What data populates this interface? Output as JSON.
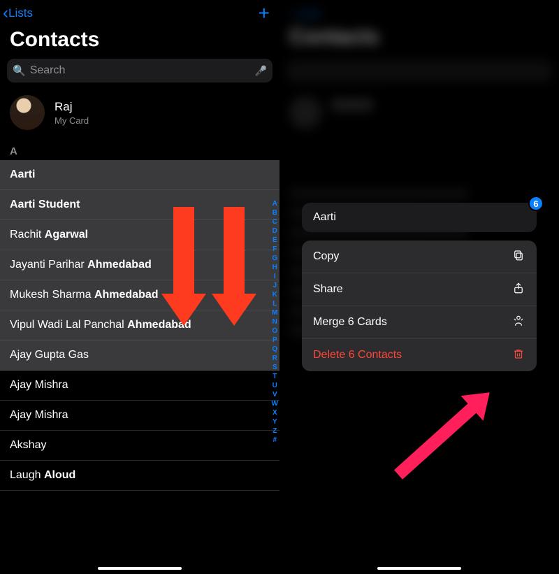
{
  "left": {
    "back_label": "Lists",
    "title": "Contacts",
    "search_placeholder": "Search",
    "me": {
      "name": "Raj",
      "subtitle": "My Card"
    },
    "section_letter": "A",
    "rows": [
      {
        "first": "",
        "last": "Aarti",
        "selected": true
      },
      {
        "first": "",
        "last": "Aarti Student",
        "selected": true
      },
      {
        "first": "Rachit",
        "last": "Agarwal",
        "selected": true
      },
      {
        "first": "Jayanti Parihar",
        "last": "Ahmedabad",
        "selected": true
      },
      {
        "first": "Mukesh Sharma",
        "last": "Ahmedabad",
        "selected": true
      },
      {
        "first": "Vipul Wadi Lal Panchal",
        "last": "Ahmedabad",
        "selected": true
      },
      {
        "first": "Ajay Gupta Gas",
        "last": "",
        "selected": true
      },
      {
        "first": "Ajay Mishra",
        "last": "",
        "selected": false
      },
      {
        "first": "Ajay Mishra",
        "last": "",
        "selected": false
      },
      {
        "first": "Akshay",
        "last": "",
        "selected": false
      },
      {
        "first": "Laugh",
        "last": "Aloud",
        "selected": false
      }
    ],
    "index_letters": [
      "A",
      "B",
      "C",
      "D",
      "E",
      "F",
      "G",
      "H",
      "I",
      "J",
      "K",
      "L",
      "M",
      "N",
      "O",
      "P",
      "Q",
      "R",
      "S",
      "T",
      "U",
      "V",
      "W",
      "X",
      "Y",
      "Z",
      "#"
    ]
  },
  "right": {
    "selected_name": "Aarti",
    "badge_count": "6",
    "menu": {
      "copy": "Copy",
      "share": "Share",
      "merge": "Merge 6 Cards",
      "delete": "Delete 6 Contacts"
    }
  }
}
